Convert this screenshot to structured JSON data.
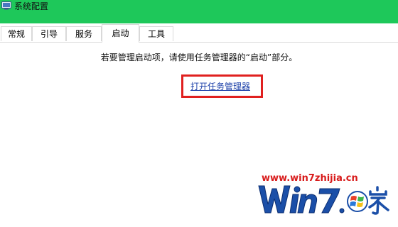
{
  "window": {
    "title": "系统配置"
  },
  "tabs": [
    {
      "label": "常规",
      "active": false
    },
    {
      "label": "引导",
      "active": false
    },
    {
      "label": "服务",
      "active": false
    },
    {
      "label": "启动",
      "active": true
    },
    {
      "label": "工具",
      "active": false
    }
  ],
  "startup": {
    "instruction": "若要管理启动项，请使用任务管理器的“启动”部分。",
    "open_task_manager_link": "打开任务管理器"
  },
  "watermark": {
    "url": "www.win7zhijia.cn",
    "logo_text": "Win7系统之家"
  },
  "colors": {
    "titlebar_bg": "#1ec85a",
    "highlight_border": "#e0201f",
    "link": "#1a3ea8",
    "watermark_red": "#d81a1a",
    "watermark_blue": "#1b4fa8"
  }
}
